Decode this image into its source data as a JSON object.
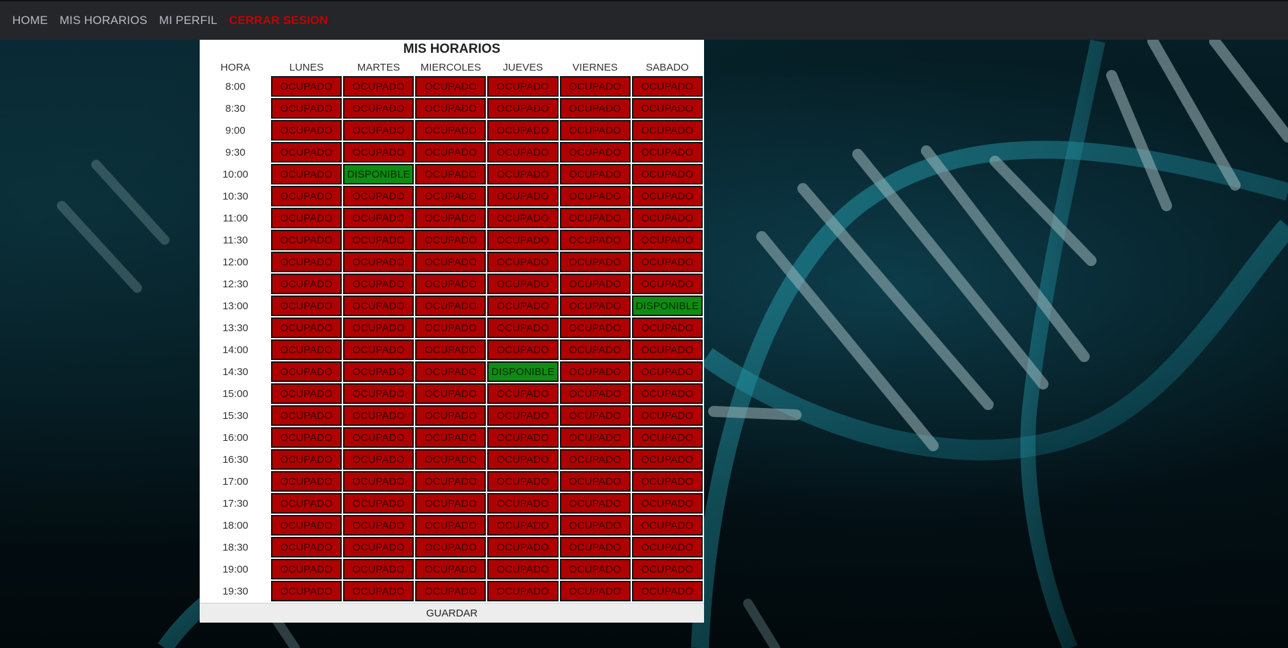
{
  "nav": {
    "items": [
      {
        "label": "HOME",
        "name": "nav-home"
      },
      {
        "label": "MIS HORARIOS",
        "name": "nav-mis-horarios"
      },
      {
        "label": "MI PERFIL",
        "name": "nav-mi-perfil"
      },
      {
        "label": "CERRAR SESION",
        "name": "nav-cerrar-sesion"
      }
    ]
  },
  "schedule": {
    "title": "MIS HORARIOS",
    "hora_header": "HORA",
    "days": [
      "LUNES",
      "MARTES",
      "MIERCOLES",
      "JUEVES",
      "VIERNES",
      "SABADO"
    ],
    "busy_label": "OCUPADO",
    "free_label": "DISPONIBLE",
    "rows": [
      {
        "hora": "8:00",
        "slots": [
          "OCUPADO",
          "OCUPADO",
          "OCUPADO",
          "OCUPADO",
          "OCUPADO",
          "OCUPADO"
        ]
      },
      {
        "hora": "8:30",
        "slots": [
          "OCUPADO",
          "OCUPADO",
          "OCUPADO",
          "OCUPADO",
          "OCUPADO",
          "OCUPADO"
        ]
      },
      {
        "hora": "9:00",
        "slots": [
          "OCUPADO",
          "OCUPADO",
          "OCUPADO",
          "OCUPADO",
          "OCUPADO",
          "OCUPADO"
        ]
      },
      {
        "hora": "9:30",
        "slots": [
          "OCUPADO",
          "OCUPADO",
          "OCUPADO",
          "OCUPADO",
          "OCUPADO",
          "OCUPADO"
        ]
      },
      {
        "hora": "10:00",
        "slots": [
          "OCUPADO",
          "DISPONIBLE",
          "OCUPADO",
          "OCUPADO",
          "OCUPADO",
          "OCUPADO"
        ]
      },
      {
        "hora": "10:30",
        "slots": [
          "OCUPADO",
          "OCUPADO",
          "OCUPADO",
          "OCUPADO",
          "OCUPADO",
          "OCUPADO"
        ]
      },
      {
        "hora": "11:00",
        "slots": [
          "OCUPADO",
          "OCUPADO",
          "OCUPADO",
          "OCUPADO",
          "OCUPADO",
          "OCUPADO"
        ]
      },
      {
        "hora": "11:30",
        "slots": [
          "OCUPADO",
          "OCUPADO",
          "OCUPADO",
          "OCUPADO",
          "OCUPADO",
          "OCUPADO"
        ]
      },
      {
        "hora": "12:00",
        "slots": [
          "OCUPADO",
          "OCUPADO",
          "OCUPADO",
          "OCUPADO",
          "OCUPADO",
          "OCUPADO"
        ]
      },
      {
        "hora": "12:30",
        "slots": [
          "OCUPADO",
          "OCUPADO",
          "OCUPADO",
          "OCUPADO",
          "OCUPADO",
          "OCUPADO"
        ]
      },
      {
        "hora": "13:00",
        "slots": [
          "OCUPADO",
          "OCUPADO",
          "OCUPADO",
          "OCUPADO",
          "OCUPADO",
          "DISPONIBLE"
        ]
      },
      {
        "hora": "13:30",
        "slots": [
          "OCUPADO",
          "OCUPADO",
          "OCUPADO",
          "OCUPADO",
          "OCUPADO",
          "OCUPADO"
        ]
      },
      {
        "hora": "14:00",
        "slots": [
          "OCUPADO",
          "OCUPADO",
          "OCUPADO",
          "OCUPADO",
          "OCUPADO",
          "OCUPADO"
        ]
      },
      {
        "hora": "14:30",
        "slots": [
          "OCUPADO",
          "OCUPADO",
          "OCUPADO",
          "DISPONIBLE",
          "OCUPADO",
          "OCUPADO"
        ]
      },
      {
        "hora": "15:00",
        "slots": [
          "OCUPADO",
          "OCUPADO",
          "OCUPADO",
          "OCUPADO",
          "OCUPADO",
          "OCUPADO"
        ]
      },
      {
        "hora": "15:30",
        "slots": [
          "OCUPADO",
          "OCUPADO",
          "OCUPADO",
          "OCUPADO",
          "OCUPADO",
          "OCUPADO"
        ]
      },
      {
        "hora": "16:00",
        "slots": [
          "OCUPADO",
          "OCUPADO",
          "OCUPADO",
          "OCUPADO",
          "OCUPADO",
          "OCUPADO"
        ]
      },
      {
        "hora": "16:30",
        "slots": [
          "OCUPADO",
          "OCUPADO",
          "OCUPADO",
          "OCUPADO",
          "OCUPADO",
          "OCUPADO"
        ]
      },
      {
        "hora": "17:00",
        "slots": [
          "OCUPADO",
          "OCUPADO",
          "OCUPADO",
          "OCUPADO",
          "OCUPADO",
          "OCUPADO"
        ]
      },
      {
        "hora": "17:30",
        "slots": [
          "OCUPADO",
          "OCUPADO",
          "OCUPADO",
          "OCUPADO",
          "OCUPADO",
          "OCUPADO"
        ]
      },
      {
        "hora": "18:00",
        "slots": [
          "OCUPADO",
          "OCUPADO",
          "OCUPADO",
          "OCUPADO",
          "OCUPADO",
          "OCUPADO"
        ]
      },
      {
        "hora": "18:30",
        "slots": [
          "OCUPADO",
          "OCUPADO",
          "OCUPADO",
          "OCUPADO",
          "OCUPADO",
          "OCUPADO"
        ]
      },
      {
        "hora": "19:00",
        "slots": [
          "OCUPADO",
          "OCUPADO",
          "OCUPADO",
          "OCUPADO",
          "OCUPADO",
          "OCUPADO"
        ]
      },
      {
        "hora": "19:30",
        "slots": [
          "OCUPADO",
          "OCUPADO",
          "OCUPADO",
          "OCUPADO",
          "OCUPADO",
          "OCUPADO"
        ]
      }
    ],
    "save_label": "GUARDAR"
  },
  "colors": {
    "navbar": "#24262a",
    "logout": "#c40000",
    "busy": "#b00000",
    "free": "#0f8c12"
  }
}
